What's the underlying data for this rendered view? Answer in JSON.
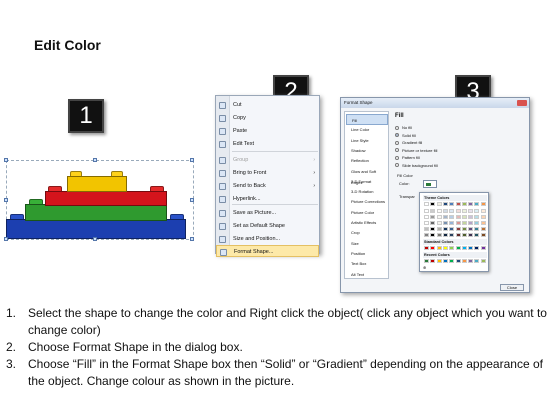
{
  "title": "Edit Color",
  "badges": [
    "1",
    "2",
    "3"
  ],
  "context_menu": {
    "items": [
      {
        "label": "Cut",
        "disabled": false,
        "arrow": false
      },
      {
        "label": "Copy",
        "disabled": false,
        "arrow": false
      },
      {
        "label": "Paste",
        "disabled": false,
        "arrow": false
      },
      {
        "label": "Edit Text",
        "disabled": false,
        "arrow": false
      },
      {
        "label": "Group",
        "disabled": true,
        "arrow": true
      },
      {
        "label": "Bring to Front",
        "disabled": false,
        "arrow": true
      },
      {
        "label": "Send to Back",
        "disabled": false,
        "arrow": true
      },
      {
        "label": "Hyperlink...",
        "disabled": false,
        "arrow": false
      },
      {
        "label": "Save as Picture...",
        "disabled": false,
        "arrow": false
      },
      {
        "label": "Set as Default Shape",
        "disabled": false,
        "arrow": false
      },
      {
        "label": "Size and Position...",
        "disabled": false,
        "arrow": false
      },
      {
        "label": "Format Shape...",
        "disabled": false,
        "arrow": false,
        "highlighted": true
      }
    ]
  },
  "dialog": {
    "title": "Format Shape",
    "categories": [
      "Fill",
      "Line Color",
      "Line Style",
      "Shadow",
      "Reflection",
      "Glow and Soft Edges",
      "3-D Format",
      "3-D Rotation",
      "Picture Corrections",
      "Picture Color",
      "Artistic Effects",
      "Crop",
      "Size",
      "Position",
      "Text Box",
      "Alt Text"
    ],
    "fill_heading": "Fill",
    "fill_options": [
      {
        "label": "No fill",
        "selected": false
      },
      {
        "label": "Solid fill",
        "selected": true
      },
      {
        "label": "Gradient fill",
        "selected": false
      },
      {
        "label": "Picture or texture fill",
        "selected": false
      },
      {
        "label": "Pattern fill",
        "selected": false
      },
      {
        "label": "Slide background fill",
        "selected": false
      }
    ],
    "fill_color_heading": "Fill Color",
    "color_label": "Color:",
    "transparency_label": "Transpar",
    "palette": {
      "theme_heading": "Theme Colors",
      "standard_heading": "Standard Colors",
      "recent_heading": "Recent Colors",
      "more_colors": "⊕",
      "theme_top": [
        "#ffffff",
        "#000000",
        "#eeece1",
        "#1f497d",
        "#4f81bd",
        "#c0504d",
        "#9bbb59",
        "#8064a2",
        "#4bacc6",
        "#f79646"
      ],
      "standard": [
        "#c00000",
        "#ff0000",
        "#ffc000",
        "#ffff00",
        "#92d050",
        "#00b050",
        "#00b0f0",
        "#0070c0",
        "#002060",
        "#7030a0"
      ],
      "recent": [
        "#2a7a3a",
        "#c00000",
        "#ffc000",
        "#0070c0",
        "#00b050",
        "#1f497d",
        "#f79646",
        "#8064a2",
        "#4bacc6",
        "#9bbb59"
      ]
    },
    "close_label": "Close"
  },
  "instructions": [
    {
      "num": "1.",
      "text": "Select the shape to change the color and Right click the object( click any object which you want to change color)"
    },
    {
      "num": "2.",
      "text": "Choose Format Shape in the dialog box."
    },
    {
      "num": "3.",
      "text": "Choose “Fill” in the Format Shape box then “Solid” or “Gradient” depending on the appearance of the object. Change colour as shown in the picture."
    }
  ],
  "colors": {
    "brick_yellow": "#f2c400",
    "brick_red": "#d4141c",
    "brick_green": "#2f9a2f",
    "brick_blue": "#1c3fb0",
    "menu_highlight": "#fde9a8"
  }
}
